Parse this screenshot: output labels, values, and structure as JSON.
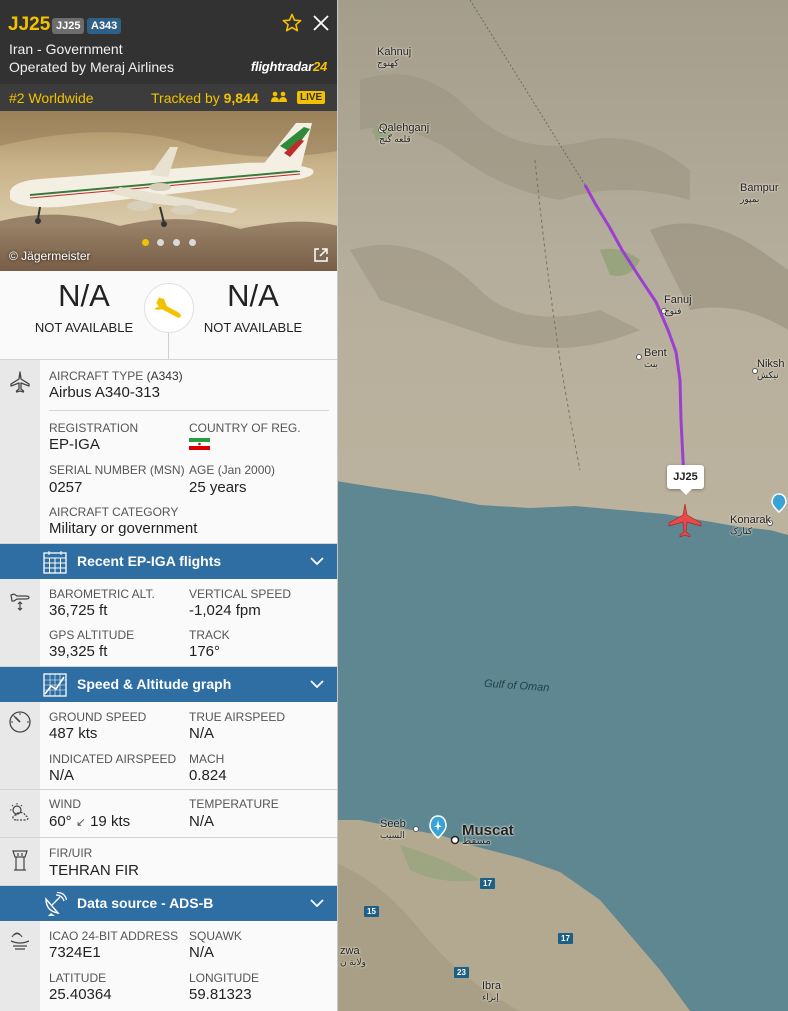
{
  "header": {
    "callsign": "JJ25",
    "chip_flight": "JJ25",
    "chip_type": "A343",
    "airline": "Iran - Government",
    "operator": "Operated by Meraj Airlines",
    "logo_main": "flightradar",
    "logo_num": "24"
  },
  "rankbar": {
    "rank": "#2 Worldwide",
    "tracked_prefix": "Tracked by",
    "tracked_count": "9,844",
    "live": "LIVE"
  },
  "photo": {
    "credit": "© Jägermeister"
  },
  "route": {
    "origin_value": "N/A",
    "origin_sub": "NOT AVAILABLE",
    "dest_value": "N/A",
    "dest_sub": "NOT AVAILABLE"
  },
  "aircraft": {
    "type_label": "AIRCRAFT TYPE",
    "type_code": "(A343)",
    "type_value": "Airbus A340-313",
    "reg_label": "REGISTRATION",
    "reg_value": "EP-IGA",
    "country_label": "COUNTRY OF REG.",
    "serial_label": "SERIAL NUMBER (MSN)",
    "serial_value": "0257",
    "age_label": "AGE",
    "age_date": "(Jan 2000)",
    "age_value": "25 years",
    "category_label": "AIRCRAFT CATEGORY",
    "category_value": "Military or government"
  },
  "bars": {
    "recent": "Recent EP-IGA flights",
    "graph": "Speed & Altitude graph",
    "source": "Data source - ADS-B"
  },
  "altitude": {
    "baro_label": "BAROMETRIC ALT.",
    "baro_value": "36,725 ft",
    "vs_label": "VERTICAL SPEED",
    "vs_value": "-1,024 fpm",
    "gps_label": "GPS ALTITUDE",
    "gps_value": "39,325 ft",
    "track_label": "TRACK",
    "track_value": "176°"
  },
  "speed": {
    "gs_label": "GROUND SPEED",
    "gs_value": "487 kts",
    "tas_label": "TRUE AIRSPEED",
    "tas_value": "N/A",
    "ias_label": "INDICATED AIRSPEED",
    "ias_value": "N/A",
    "mach_label": "MACH",
    "mach_value": "0.824"
  },
  "weather": {
    "wind_label": "WIND",
    "wind_dir": "60°",
    "wind_arrow": "↙",
    "wind_speed": "19 kts",
    "temp_label": "TEMPERATURE",
    "temp_value": "N/A"
  },
  "fir": {
    "label": "FIR/UIR",
    "value": "TEHRAN FIR"
  },
  "source": {
    "icao_label": "ICAO 24-BIT ADDRESS",
    "icao_value": "7324E1",
    "squawk_label": "SQUAWK",
    "squawk_value": "N/A",
    "lat_label": "LATITUDE",
    "lat_value": "25.40364",
    "lon_label": "LONGITUDE",
    "lon_value": "59.81323"
  },
  "map": {
    "flight_tag": "JJ25",
    "places": [
      {
        "name": "Kahnuj",
        "ar": "کهنوج"
      },
      {
        "name": "Qalehganj",
        "ar": "قلعه گنج"
      },
      {
        "name": "Bampur",
        "ar": "بمپور"
      },
      {
        "name": "Fanuj",
        "ar": "فنوج"
      },
      {
        "name": "Bent",
        "ar": "بنت"
      },
      {
        "name": "Niksh",
        "ar": "نیکش"
      },
      {
        "name": "Konarak",
        "ar": "کنارک"
      },
      {
        "name": "Seeb",
        "ar": "السيب"
      },
      {
        "name": "Muscat",
        "ar": "مسقط"
      },
      {
        "name": "Ibra",
        "ar": "إبراء"
      },
      {
        "name": "zwa",
        "ar": "ولاية ن"
      }
    ],
    "sea": "Gulf of Oman",
    "roads": [
      "17",
      "15",
      "17",
      "23"
    ]
  },
  "colors": {
    "accent": "#f2c200",
    "bar": "#2e6ea3",
    "route": "#9b3fd0",
    "plane": "#e84a4a"
  }
}
